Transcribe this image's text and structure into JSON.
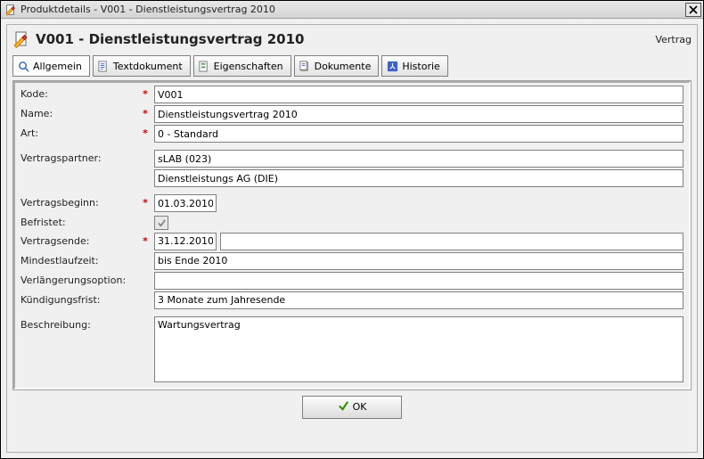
{
  "window": {
    "title": "Produktdetails - V001 - Dienstleistungsvertrag 2010"
  },
  "header": {
    "title": "V001 - Dienstleistungsvertrag 2010",
    "context": "Vertrag"
  },
  "tabs": [
    {
      "label": "Allgemein"
    },
    {
      "label": "Textdokument"
    },
    {
      "label": "Eigenschaften"
    },
    {
      "label": "Dokumente"
    },
    {
      "label": "Historie"
    }
  ],
  "fields": {
    "kode": {
      "label": "Kode:",
      "value": "V001",
      "required": true
    },
    "name": {
      "label": "Name:",
      "value": "Dienstleistungsvertrag 2010",
      "required": true
    },
    "art": {
      "label": "Art:",
      "value": "0 - Standard",
      "required": true
    },
    "vertragspartner": {
      "label": "Vertragspartner:",
      "value1": "sLAB (023)",
      "value2": "Dienstleistungs AG (DIE)"
    },
    "vertragsbeginn": {
      "label": "Vertragsbeginn:",
      "value": "01.03.2010",
      "required": true
    },
    "befristet": {
      "label": "Befristet:",
      "checked": true
    },
    "vertragsende": {
      "label": "Vertragsende:",
      "value": "31.12.2010",
      "value2": "",
      "required": true
    },
    "mindestlaufzeit": {
      "label": "Mindestlaufzeit:",
      "value": "bis Ende 2010"
    },
    "verlaengerungsoption": {
      "label": "Verlängerungsoption:",
      "value": ""
    },
    "kuendigungsfrist": {
      "label": "Kündigungsfrist:",
      "value": "3 Monate zum Jahresende"
    },
    "beschreibung": {
      "label": "Beschreibung:",
      "value": "Wartungsvertrag"
    }
  },
  "buttons": {
    "ok": "OK"
  },
  "required_marker": "*"
}
